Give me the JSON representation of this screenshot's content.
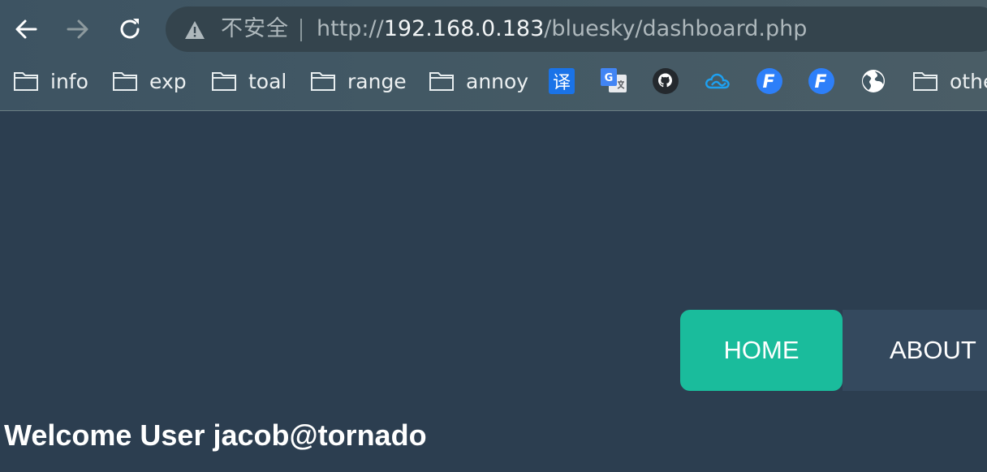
{
  "browser": {
    "security_label": "不安全",
    "url_scheme": "http://",
    "url_host": "192.168.0.183",
    "url_path": "/bluesky/dashboard.php"
  },
  "bookmarks": {
    "folders": [
      {
        "label": "info",
        "icon": "folder-icon"
      },
      {
        "label": "exp",
        "icon": "folder-icon"
      },
      {
        "label": "toal",
        "icon": "folder-icon"
      },
      {
        "label": "range",
        "icon": "folder-icon"
      },
      {
        "label": "annoy",
        "icon": "folder-icon"
      },
      {
        "label": "othe",
        "icon": "folder-icon"
      }
    ],
    "icons": [
      {
        "name": "translate-icon",
        "glyph": "译",
        "color": "#1a73e8"
      },
      {
        "name": "google-translate-icon",
        "glyph": "G",
        "color": "#4285f4"
      },
      {
        "name": "github-icon",
        "color": "#24292e"
      },
      {
        "name": "cloud-icon",
        "color": "#1da1f2"
      },
      {
        "name": "fofa-icon",
        "glyph": "F",
        "color": "#2d7ff9"
      },
      {
        "name": "fofa-icon-2",
        "glyph": "F",
        "color": "#2d7ff9"
      },
      {
        "name": "globe-icon",
        "color": "#ffffff"
      }
    ]
  },
  "site_nav": {
    "home_label": "HOME",
    "about_label": "ABOUT"
  },
  "main": {
    "welcome_text": "Welcome User jacob@tornado"
  },
  "colors": {
    "page_background": "#2c3e50",
    "nav_active": "#1abc9c",
    "nav_inactive": "#34495e"
  }
}
